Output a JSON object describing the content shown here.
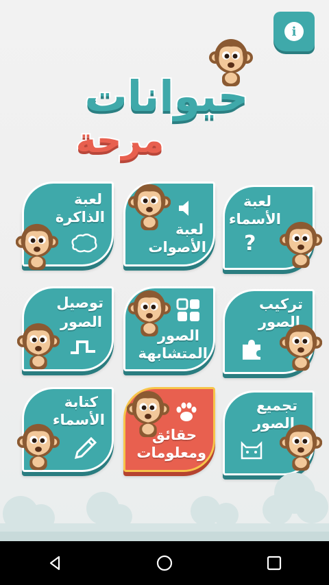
{
  "app": {
    "title_line1": "حيوانات",
    "title_line2": "مرحة",
    "info_label": "i"
  },
  "tiles": [
    {
      "id": "memory",
      "label_line1": "لعبة",
      "label_line2": "الذاكرة",
      "icon": "brain-icon",
      "color": "#3fa9aa"
    },
    {
      "id": "sounds",
      "label_line1": "لعبة",
      "label_line2": "الأصوات",
      "icon": "speaker-icon",
      "color": "#3fa9aa"
    },
    {
      "id": "names",
      "label_line1": "لعبة",
      "label_line2": "الأسماء",
      "icon": "question-icon",
      "color": "#3fa9aa"
    },
    {
      "id": "connect",
      "label_line1": "توصيل",
      "label_line2": "الصور",
      "icon": "connect-icon",
      "color": "#3fa9aa"
    },
    {
      "id": "similar",
      "label_line1": "الصور",
      "label_line2": "المتشابهة",
      "icon": "grid-icon",
      "color": "#3fa9aa"
    },
    {
      "id": "puzzle",
      "label_line1": "تركيب",
      "label_line2": "الصور",
      "icon": "puzzle-icon",
      "color": "#3fa9aa"
    },
    {
      "id": "write",
      "label_line1": "كتابة",
      "label_line2": "الأسماء",
      "icon": "pencil-icon",
      "color": "#3fa9aa"
    },
    {
      "id": "facts",
      "label_line1": "حقائق",
      "label_line2": "ومعلومات",
      "icon": "paw-icon",
      "color": "#e8604f"
    },
    {
      "id": "collect",
      "label_line1": "تجميع",
      "label_line2": "الصور",
      "icon": "cat-icon",
      "color": "#3fa9aa"
    }
  ],
  "navbar": {
    "back": "back-icon",
    "home": "home-icon",
    "recents": "recents-icon"
  }
}
